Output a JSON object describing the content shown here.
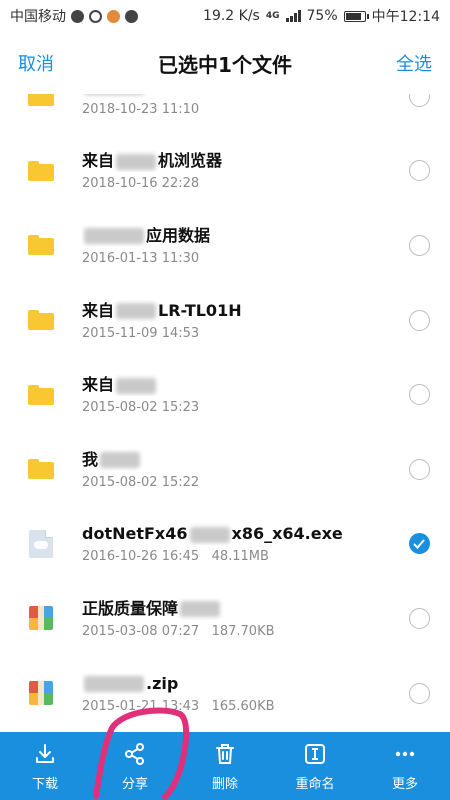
{
  "status_bar": {
    "carrier": "中国移动",
    "speed": "19.2 K/s",
    "network": "4G",
    "battery": "75%",
    "time": "中午12:14"
  },
  "header": {
    "cancel": "取消",
    "title": "已选中1个文件",
    "select_all": "全选"
  },
  "files": [
    {
      "type": "folder",
      "name_visible": "",
      "name_suffix": "",
      "date": "2018-10-23",
      "time": "11:10",
      "size": "",
      "checked": false
    },
    {
      "type": "folder",
      "name_visible": "来自",
      "name_suffix": "机浏览器",
      "date": "2018-10-16",
      "time": "22:28",
      "size": "",
      "checked": false
    },
    {
      "type": "folder",
      "name_visible": "",
      "name_suffix": "应用数据",
      "date": "2016-01-13",
      "time": "11:30",
      "size": "",
      "checked": false
    },
    {
      "type": "folder",
      "name_visible": "来自",
      "name_suffix": "LR-TL01H",
      "date": "2015-11-09",
      "time": "14:53",
      "size": "",
      "checked": false
    },
    {
      "type": "folder",
      "name_visible": "来自",
      "name_suffix": "",
      "date": "2015-08-02",
      "time": "15:23",
      "size": "",
      "checked": false
    },
    {
      "type": "folder",
      "name_visible": "我",
      "name_suffix": "",
      "date": "2015-08-02",
      "time": "15:22",
      "size": "",
      "checked": false
    },
    {
      "type": "exe",
      "name_visible": "dotNetFx46",
      "name_suffix": "x86_x64.exe",
      "date": "2016-10-26",
      "time": "16:45",
      "size": "48.11MB",
      "checked": true
    },
    {
      "type": "zip",
      "name_visible": "正版质量保障",
      "name_suffix": "",
      "date": "2015-03-08",
      "time": "07:27",
      "size": "187.70KB",
      "checked": false
    },
    {
      "type": "zip",
      "name_visible": "",
      "name_suffix": ".zip",
      "date": "2015-01-21",
      "time": "13:43",
      "size": "165.60KB",
      "checked": false
    }
  ],
  "bottom_bar": [
    {
      "label": "下载",
      "icon": "download-icon"
    },
    {
      "label": "分享",
      "icon": "share-icon"
    },
    {
      "label": "删除",
      "icon": "trash-icon"
    },
    {
      "label": "重命名",
      "icon": "rename-icon"
    },
    {
      "label": "更多",
      "icon": "more-icon"
    }
  ],
  "colors": {
    "accent": "#1a8fde",
    "folder": "#f8c832",
    "annotation": "#e0307a"
  }
}
